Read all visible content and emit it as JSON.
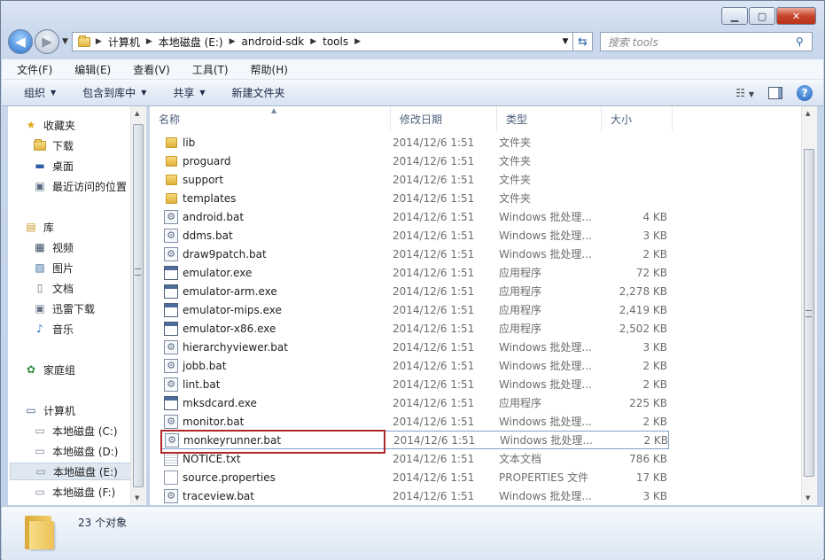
{
  "window": {
    "minimize": "▁",
    "maximize": "▢",
    "close": "✕"
  },
  "address": {
    "crumbs": [
      "计算机",
      "本地磁盘 (E:)",
      "android-sdk",
      "tools"
    ],
    "search_placeholder": "搜索 tools"
  },
  "menu": [
    "文件(F)",
    "编辑(E)",
    "查看(V)",
    "工具(T)",
    "帮助(H)"
  ],
  "toolbar": {
    "organize": "组织",
    "include": "包含到库中",
    "share": "共享",
    "newfolder": "新建文件夹"
  },
  "nav": {
    "favorites": "收藏夹",
    "fav_items": [
      "下载",
      "桌面",
      "最近访问的位置"
    ],
    "libraries": "库",
    "lib_items": [
      "视频",
      "图片",
      "文档",
      "迅雷下载",
      "音乐"
    ],
    "homegroup": "家庭组",
    "computer": "计算机",
    "drives": [
      "本地磁盘 (C:)",
      "本地磁盘 (D:)",
      "本地磁盘 (E:)",
      "本地磁盘 (F:)"
    ]
  },
  "columns": [
    "名称",
    "修改日期",
    "类型",
    "大小"
  ],
  "files": [
    {
      "name": "lib",
      "date": "2014/12/6 1:51",
      "type": "文件夹",
      "size": "",
      "icon": "folder"
    },
    {
      "name": "proguard",
      "date": "2014/12/6 1:51",
      "type": "文件夹",
      "size": "",
      "icon": "folder"
    },
    {
      "name": "support",
      "date": "2014/12/6 1:51",
      "type": "文件夹",
      "size": "",
      "icon": "folder"
    },
    {
      "name": "templates",
      "date": "2014/12/6 1:51",
      "type": "文件夹",
      "size": "",
      "icon": "folder"
    },
    {
      "name": "android.bat",
      "date": "2014/12/6 1:51",
      "type": "Windows 批处理...",
      "size": "4 KB",
      "icon": "bat"
    },
    {
      "name": "ddms.bat",
      "date": "2014/12/6 1:51",
      "type": "Windows 批处理...",
      "size": "3 KB",
      "icon": "bat"
    },
    {
      "name": "draw9patch.bat",
      "date": "2014/12/6 1:51",
      "type": "Windows 批处理...",
      "size": "2 KB",
      "icon": "bat"
    },
    {
      "name": "emulator.exe",
      "date": "2014/12/6 1:51",
      "type": "应用程序",
      "size": "72 KB",
      "icon": "exe"
    },
    {
      "name": "emulator-arm.exe",
      "date": "2014/12/6 1:51",
      "type": "应用程序",
      "size": "2,278 KB",
      "icon": "exe"
    },
    {
      "name": "emulator-mips.exe",
      "date": "2014/12/6 1:51",
      "type": "应用程序",
      "size": "2,419 KB",
      "icon": "exe"
    },
    {
      "name": "emulator-x86.exe",
      "date": "2014/12/6 1:51",
      "type": "应用程序",
      "size": "2,502 KB",
      "icon": "exe"
    },
    {
      "name": "hierarchyviewer.bat",
      "date": "2014/12/6 1:51",
      "type": "Windows 批处理...",
      "size": "3 KB",
      "icon": "bat"
    },
    {
      "name": "jobb.bat",
      "date": "2014/12/6 1:51",
      "type": "Windows 批处理...",
      "size": "2 KB",
      "icon": "bat"
    },
    {
      "name": "lint.bat",
      "date": "2014/12/6 1:51",
      "type": "Windows 批处理...",
      "size": "2 KB",
      "icon": "bat"
    },
    {
      "name": "mksdcard.exe",
      "date": "2014/12/6 1:51",
      "type": "应用程序",
      "size": "225 KB",
      "icon": "exe"
    },
    {
      "name": "monitor.bat",
      "date": "2014/12/6 1:51",
      "type": "Windows 批处理...",
      "size": "2 KB",
      "icon": "bat"
    },
    {
      "name": "monkeyrunner.bat",
      "date": "2014/12/6 1:51",
      "type": "Windows 批处理...",
      "size": "2 KB",
      "icon": "bat"
    },
    {
      "name": "NOTICE.txt",
      "date": "2014/12/6 1:51",
      "type": "文本文档",
      "size": "786 KB",
      "icon": "txt"
    },
    {
      "name": "source.properties",
      "date": "2014/12/6 1:51",
      "type": "PROPERTIES 文件",
      "size": "17 KB",
      "icon": "file"
    },
    {
      "name": "traceview.bat",
      "date": "2014/12/6 1:51",
      "type": "Windows 批处理...",
      "size": "3 KB",
      "icon": "bat"
    }
  ],
  "status": {
    "count": "23 个对象"
  }
}
